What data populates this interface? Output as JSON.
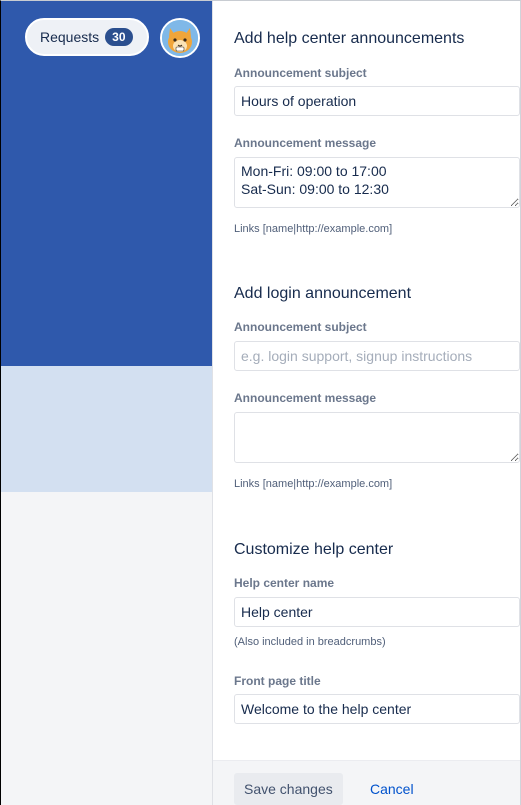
{
  "preview": {
    "requests_label": "Requests",
    "requests_count": "30",
    "colors": {
      "header": "#2f59ac",
      "band": "#d3e0f1",
      "body": "#f4f5f7"
    },
    "avatar_icon": "cat-avatar-icon"
  },
  "help_center_announcements": {
    "title": "Add help center announcements",
    "subject_label": "Announcement subject",
    "subject_value": "Hours of operation",
    "message_label": "Announcement message",
    "message_value": "Mon-Fri: 09:00 to 17:00\nSat-Sun: 09:00 to 12:30",
    "links_hint": "Links [name|http://example.com]"
  },
  "login_announcement": {
    "title": "Add login announcement",
    "subject_label": "Announcement subject",
    "subject_placeholder": "e.g. login support, signup instructions",
    "subject_value": "",
    "message_label": "Announcement message",
    "message_value": "",
    "links_hint": "Links [name|http://example.com]"
  },
  "customize": {
    "title": "Customize help center",
    "name_label": "Help center name",
    "name_value": "Help center",
    "name_hint": "(Also included in breadcrumbs)",
    "front_title_label": "Front page title",
    "front_title_value": "Welcome to the help center"
  },
  "footer": {
    "save_label": "Save changes",
    "cancel_label": "Cancel"
  }
}
